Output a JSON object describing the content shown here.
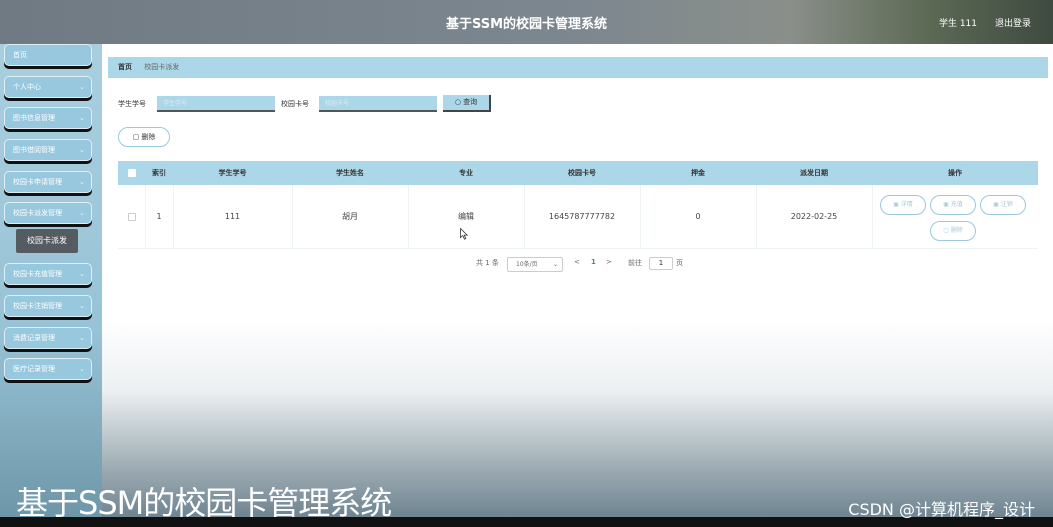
{
  "header": {
    "title": "基于SSM的校园卡管理系统",
    "user": "学生 111",
    "logout": "退出登录"
  },
  "sidebar": {
    "items": [
      {
        "label": "首页",
        "chev": ""
      },
      {
        "label": "个人中心",
        "chev": "⌄"
      },
      {
        "label": "图书信息管理",
        "chev": "⌄"
      },
      {
        "label": "图书借阅管理",
        "chev": "⌄"
      },
      {
        "label": "校园卡申请管理",
        "chev": "⌄"
      },
      {
        "label": "校园卡派发管理",
        "chev": "⌄"
      },
      {
        "label": "校园卡充值管理",
        "chev": "⌄"
      },
      {
        "label": "校园卡注销管理",
        "chev": "⌄"
      },
      {
        "label": "消费记录管理",
        "chev": "⌄"
      },
      {
        "label": "医疗记录管理",
        "chev": "⌄"
      }
    ],
    "submenu_active": "校园卡派发"
  },
  "breadcrumb": {
    "home": "首页",
    "current": "校园卡派发"
  },
  "search": {
    "student_id_label": "学生学号",
    "student_id_placeholder": "学生学号",
    "card_no_label": "校园卡号",
    "card_no_placeholder": "校园卡号",
    "search_button": "查询"
  },
  "actions": {
    "delete_button": "删除"
  },
  "table": {
    "columns": [
      "索引",
      "学生学号",
      "学生姓名",
      "专业",
      "校园卡号",
      "押金",
      "派发日期",
      "操作"
    ],
    "rows": [
      {
        "index": "1",
        "student_id": "111",
        "student_name": "胡月",
        "major": "编辑",
        "card_no": "1645787777782",
        "deposit": "0",
        "issue_date": "2022-02-25",
        "ops": [
          "详情",
          "充值",
          "注销",
          "删除"
        ]
      }
    ]
  },
  "pagination": {
    "total": "共 1 条",
    "page_size": "10条/页",
    "prev": "<",
    "current": "1",
    "next": ">",
    "goto_label": "前往",
    "goto_value": "1",
    "page_unit": "页"
  },
  "overlay": {
    "title": "基于SSM的校园卡管理系统",
    "credit": "CSDN @计算机程序_设计"
  },
  "colors": {
    "accent": "#acd7e8",
    "sidebar": "#98c8dd"
  }
}
